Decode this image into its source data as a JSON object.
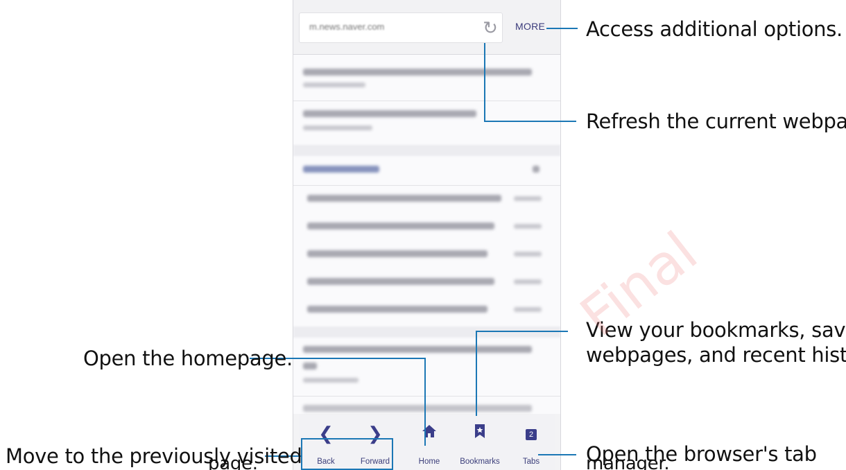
{
  "browser": {
    "url": "m.news.naver.com",
    "more_label": "MORE",
    "toolbar": {
      "back_label": "Back",
      "forward_label": "Forward",
      "home_label": "Home",
      "bookmarks_label": "Bookmarks",
      "tabs_label": "Tabs",
      "tab_count": "2"
    }
  },
  "callouts": {
    "more": "Access additional options.",
    "refresh": "Refresh the current webpage.",
    "bookmarks_line1": "View your bookmarks, saved",
    "bookmarks_line2": "webpages, and recent history.",
    "home": "Open the homepage.",
    "back_line1": "Move to the previously visited",
    "back_line2": "page.",
    "tabs_line1": "Open the browser's tab",
    "tabs_line2": "manager."
  },
  "watermark": "Final",
  "icons": [
    "refresh-icon",
    "back-icon",
    "forward-icon",
    "home-icon",
    "bookmark-icon",
    "tabs-icon"
  ],
  "accent_color": "#1b77b5"
}
